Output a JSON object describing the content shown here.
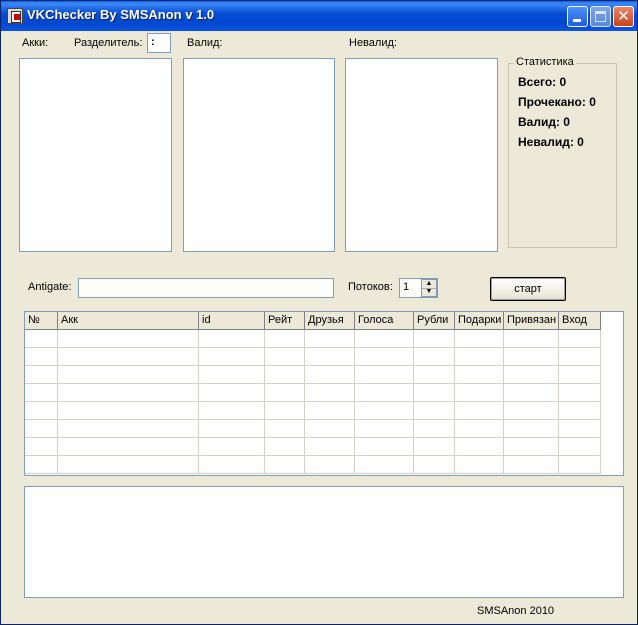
{
  "window": {
    "title": "VKChecker By SMSAnon v 1.0"
  },
  "accounts": {
    "label": "Акки:",
    "separator_label": "Разделитель:",
    "separator_value": ":"
  },
  "valid": {
    "label": "Валид:"
  },
  "invalid": {
    "label": "Невалид:"
  },
  "stats": {
    "title": "Статистика",
    "total": "Всего: 0",
    "checked": "Прочекано: 0",
    "valid": "Валид: 0",
    "invalid": "Невалид: 0"
  },
  "antigate": {
    "label": "Antigate:",
    "value": ""
  },
  "threads": {
    "label": "Потоков:",
    "value": "1"
  },
  "start_button": {
    "label": "старт"
  },
  "table": {
    "columns": [
      "№",
      "Акк",
      "id",
      "Рейт",
      "Друзья",
      "Голоса",
      "Рубли",
      "Подарки",
      "Привязан",
      "Вход"
    ]
  },
  "footer": {
    "text": "SMSAnon  2010"
  }
}
